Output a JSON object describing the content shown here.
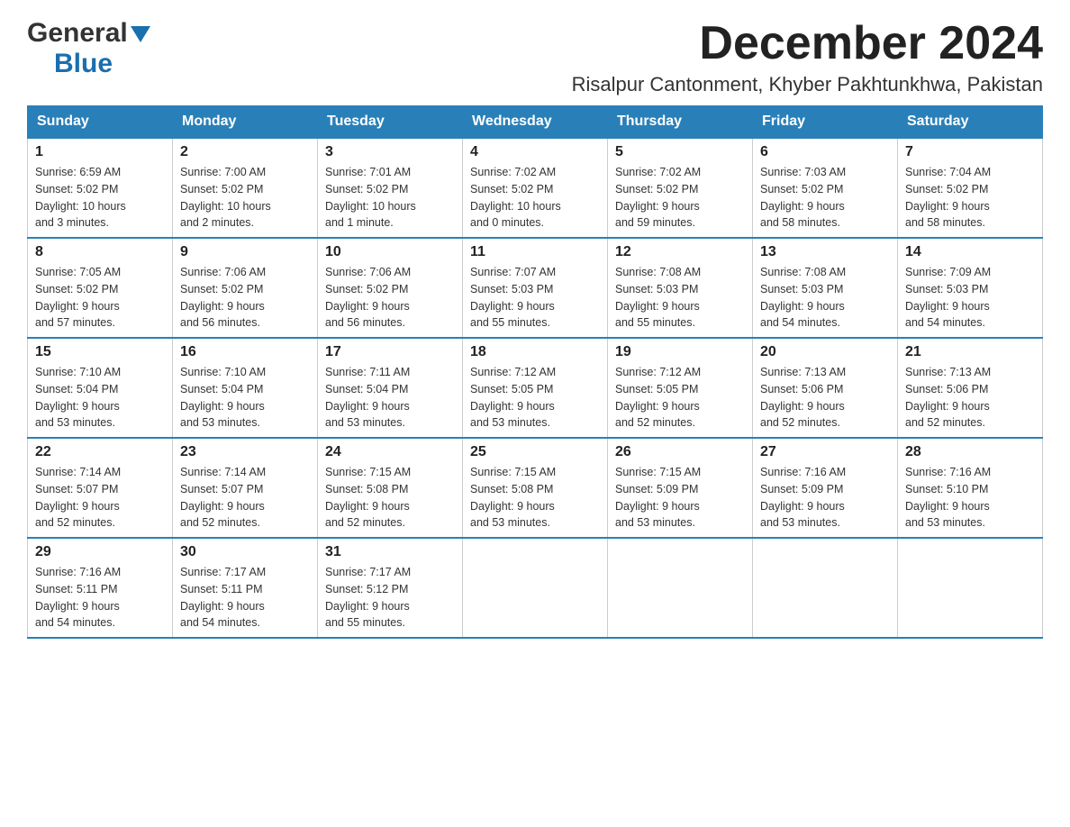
{
  "logo": {
    "general": "General",
    "blue": "Blue"
  },
  "header": {
    "month_year": "December 2024",
    "location": "Risalpur Cantonment, Khyber Pakhtunkhwa, Pakistan"
  },
  "days_of_week": [
    "Sunday",
    "Monday",
    "Tuesday",
    "Wednesday",
    "Thursday",
    "Friday",
    "Saturday"
  ],
  "weeks": [
    [
      {
        "day": "1",
        "sunrise": "6:59 AM",
        "sunset": "5:02 PM",
        "daylight": "10 hours and 3 minutes."
      },
      {
        "day": "2",
        "sunrise": "7:00 AM",
        "sunset": "5:02 PM",
        "daylight": "10 hours and 2 minutes."
      },
      {
        "day": "3",
        "sunrise": "7:01 AM",
        "sunset": "5:02 PM",
        "daylight": "10 hours and 1 minute."
      },
      {
        "day": "4",
        "sunrise": "7:02 AM",
        "sunset": "5:02 PM",
        "daylight": "10 hours and 0 minutes."
      },
      {
        "day": "5",
        "sunrise": "7:02 AM",
        "sunset": "5:02 PM",
        "daylight": "9 hours and 59 minutes."
      },
      {
        "day": "6",
        "sunrise": "7:03 AM",
        "sunset": "5:02 PM",
        "daylight": "9 hours and 58 minutes."
      },
      {
        "day": "7",
        "sunrise": "7:04 AM",
        "sunset": "5:02 PM",
        "daylight": "9 hours and 58 minutes."
      }
    ],
    [
      {
        "day": "8",
        "sunrise": "7:05 AM",
        "sunset": "5:02 PM",
        "daylight": "9 hours and 57 minutes."
      },
      {
        "day": "9",
        "sunrise": "7:06 AM",
        "sunset": "5:02 PM",
        "daylight": "9 hours and 56 minutes."
      },
      {
        "day": "10",
        "sunrise": "7:06 AM",
        "sunset": "5:02 PM",
        "daylight": "9 hours and 56 minutes."
      },
      {
        "day": "11",
        "sunrise": "7:07 AM",
        "sunset": "5:03 PM",
        "daylight": "9 hours and 55 minutes."
      },
      {
        "day": "12",
        "sunrise": "7:08 AM",
        "sunset": "5:03 PM",
        "daylight": "9 hours and 55 minutes."
      },
      {
        "day": "13",
        "sunrise": "7:08 AM",
        "sunset": "5:03 PM",
        "daylight": "9 hours and 54 minutes."
      },
      {
        "day": "14",
        "sunrise": "7:09 AM",
        "sunset": "5:03 PM",
        "daylight": "9 hours and 54 minutes."
      }
    ],
    [
      {
        "day": "15",
        "sunrise": "7:10 AM",
        "sunset": "5:04 PM",
        "daylight": "9 hours and 53 minutes."
      },
      {
        "day": "16",
        "sunrise": "7:10 AM",
        "sunset": "5:04 PM",
        "daylight": "9 hours and 53 minutes."
      },
      {
        "day": "17",
        "sunrise": "7:11 AM",
        "sunset": "5:04 PM",
        "daylight": "9 hours and 53 minutes."
      },
      {
        "day": "18",
        "sunrise": "7:12 AM",
        "sunset": "5:05 PM",
        "daylight": "9 hours and 53 minutes."
      },
      {
        "day": "19",
        "sunrise": "7:12 AM",
        "sunset": "5:05 PM",
        "daylight": "9 hours and 52 minutes."
      },
      {
        "day": "20",
        "sunrise": "7:13 AM",
        "sunset": "5:06 PM",
        "daylight": "9 hours and 52 minutes."
      },
      {
        "day": "21",
        "sunrise": "7:13 AM",
        "sunset": "5:06 PM",
        "daylight": "9 hours and 52 minutes."
      }
    ],
    [
      {
        "day": "22",
        "sunrise": "7:14 AM",
        "sunset": "5:07 PM",
        "daylight": "9 hours and 52 minutes."
      },
      {
        "day": "23",
        "sunrise": "7:14 AM",
        "sunset": "5:07 PM",
        "daylight": "9 hours and 52 minutes."
      },
      {
        "day": "24",
        "sunrise": "7:15 AM",
        "sunset": "5:08 PM",
        "daylight": "9 hours and 52 minutes."
      },
      {
        "day": "25",
        "sunrise": "7:15 AM",
        "sunset": "5:08 PM",
        "daylight": "9 hours and 53 minutes."
      },
      {
        "day": "26",
        "sunrise": "7:15 AM",
        "sunset": "5:09 PM",
        "daylight": "9 hours and 53 minutes."
      },
      {
        "day": "27",
        "sunrise": "7:16 AM",
        "sunset": "5:09 PM",
        "daylight": "9 hours and 53 minutes."
      },
      {
        "day": "28",
        "sunrise": "7:16 AM",
        "sunset": "5:10 PM",
        "daylight": "9 hours and 53 minutes."
      }
    ],
    [
      {
        "day": "29",
        "sunrise": "7:16 AM",
        "sunset": "5:11 PM",
        "daylight": "9 hours and 54 minutes."
      },
      {
        "day": "30",
        "sunrise": "7:17 AM",
        "sunset": "5:11 PM",
        "daylight": "9 hours and 54 minutes."
      },
      {
        "day": "31",
        "sunrise": "7:17 AM",
        "sunset": "5:12 PM",
        "daylight": "9 hours and 55 minutes."
      },
      null,
      null,
      null,
      null
    ]
  ],
  "labels": {
    "sunrise": "Sunrise:",
    "sunset": "Sunset:",
    "daylight": "Daylight:"
  }
}
